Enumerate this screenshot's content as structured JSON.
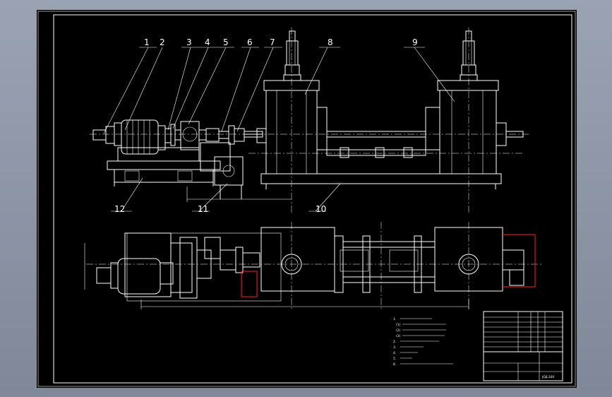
{
  "drawing": {
    "part_numbers": [
      "1",
      "2",
      "3",
      "4",
      "5",
      "6",
      "7",
      "8",
      "9",
      "10",
      "11",
      "12"
    ],
    "dimensions": {
      "top_overall": "",
      "bottom_overall": "",
      "left_height": ""
    },
    "notes": [
      "1.",
      "(1)",
      "(2)",
      "(3)",
      "2.",
      "3.",
      "4.",
      "5.",
      "6."
    ],
    "title_block": {
      "title": "",
      "drawing_no": "JGJL100"
    }
  },
  "colors": {
    "background_frame": "#000000",
    "lines": "#ffffff",
    "highlight": "#ff2020",
    "window_bg": "#8a93a3"
  }
}
